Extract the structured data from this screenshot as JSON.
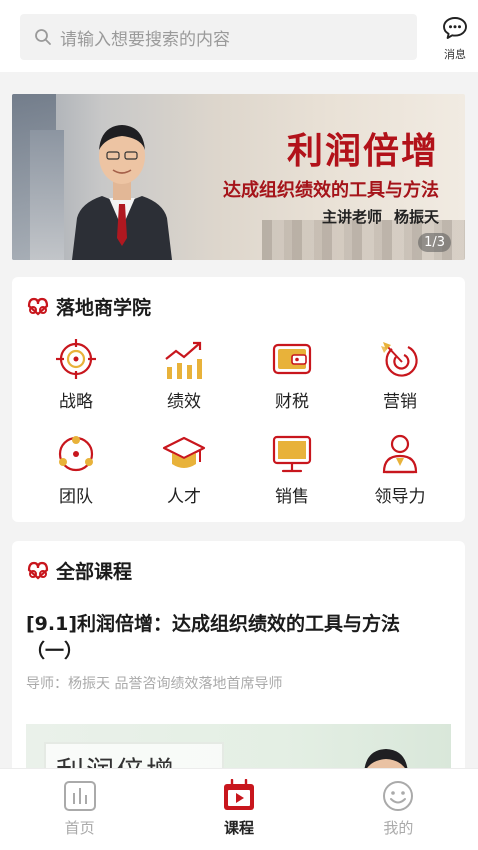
{
  "header": {
    "search_placeholder": "请输入想要搜索的内容",
    "message_label": "消息"
  },
  "banner": {
    "title": "利润倍增",
    "subtitle": "达成组织绩效的工具与方法",
    "teacher_prefix": "主讲老师",
    "teacher_name": "杨振天",
    "pager": "1/3"
  },
  "academy": {
    "title": "落地商学院",
    "items": [
      {
        "label": "战略",
        "icon": "target-icon"
      },
      {
        "label": "绩效",
        "icon": "growth-chart-icon"
      },
      {
        "label": "财税",
        "icon": "wallet-icon"
      },
      {
        "label": "营销",
        "icon": "dart-target-icon"
      },
      {
        "label": "团队",
        "icon": "team-cycle-icon"
      },
      {
        "label": "人才",
        "icon": "graduation-cap-icon"
      },
      {
        "label": "销售",
        "icon": "monitor-icon"
      },
      {
        "label": "领导力",
        "icon": "leader-icon"
      }
    ]
  },
  "courses": {
    "title": "全部课程",
    "items": [
      {
        "title": "[9.1]利润倍增：达成组织绩效的工具与方法（一）",
        "meta": "导师：杨振天 品誉咨询绩效落地首席导师",
        "thumb_text": "利润倍增"
      }
    ]
  },
  "tabbar": {
    "tabs": [
      {
        "label": "首页",
        "active": false
      },
      {
        "label": "课程",
        "active": true
      },
      {
        "label": "我的",
        "active": false
      }
    ]
  },
  "colors": {
    "accent": "#c8161d",
    "icon_gold": "#e8b23a",
    "muted": "#aaaaaa"
  }
}
